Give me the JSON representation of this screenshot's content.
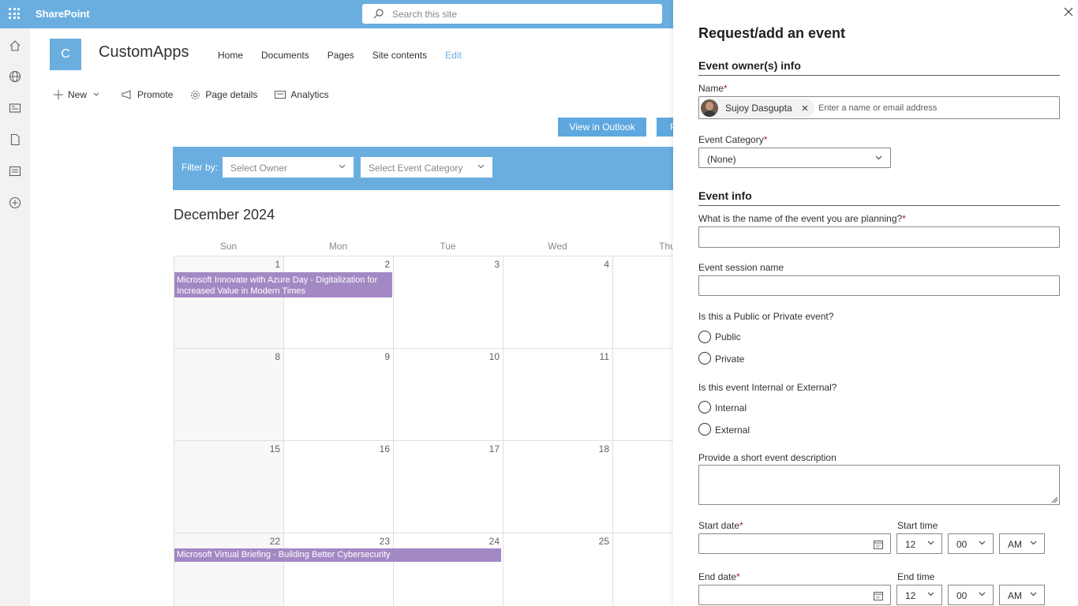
{
  "topbar": {
    "brand": "SharePoint",
    "search_placeholder": "Search this site"
  },
  "site": {
    "logo_letter": "C",
    "title": "CustomApps",
    "nav": [
      "Home",
      "Documents",
      "Pages",
      "Site contents",
      "Edit"
    ]
  },
  "commands": {
    "new": "New",
    "promote": "Promote",
    "page_details": "Page details",
    "analytics": "Analytics"
  },
  "buttons": {
    "view_outlook": "View in Outlook",
    "second": "R"
  },
  "filter": {
    "label": "Filter by:",
    "owner": "Select Owner",
    "category": "Select Event Category"
  },
  "calendar": {
    "month": "December 2024",
    "days": [
      "Sun",
      "Mon",
      "Tue",
      "Wed",
      "Thu"
    ],
    "weeks": [
      [
        "1",
        "2",
        "3",
        "4",
        ""
      ],
      [
        "8",
        "9",
        "10",
        "11",
        ""
      ],
      [
        "15",
        "16",
        "17",
        "18",
        ""
      ],
      [
        "22",
        "23",
        "24",
        "25",
        ""
      ]
    ],
    "events": [
      {
        "title": "Microsoft Innovate with Azure Day - Digitalization for Increased Value in Modern Times",
        "color": "#a389c4"
      },
      {
        "title": "Microsoft Virtual Briefing - Building Better Cybersecurity",
        "color": "#a389c4"
      }
    ]
  },
  "panel": {
    "title": "Request/add an event",
    "owner_section": "Event owner(s) info",
    "name_label": "Name",
    "person": "Sujoy Dasgupta",
    "name_placeholder": "Enter a name or email address",
    "category_label": "Event Category",
    "category_value": "(None)",
    "info_section": "Event info",
    "event_name_label": "What is the name of the event you are planning?",
    "session_label": "Event session name",
    "public_private_label": "Is this a Public or Private event?",
    "public": "Public",
    "private": "Private",
    "internal_external_label": "Is this event Internal or External?",
    "internal": "Internal",
    "external": "External",
    "description_label": "Provide a short event description",
    "start_date_label": "Start date",
    "start_time_label": "Start time",
    "end_date_label": "End date",
    "end_time_label": "End time",
    "hour": "12",
    "minute": "00",
    "ampm": "AM",
    "required_mark": "*"
  },
  "colors": {
    "accent": "#6aaee0",
    "event": "#a389c4",
    "required": "#a4262c"
  }
}
